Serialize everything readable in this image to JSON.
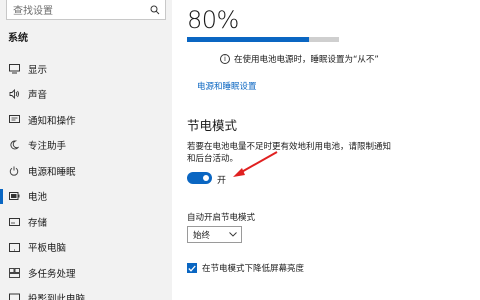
{
  "sidebar": {
    "search": {
      "placeholder": "查找设置"
    },
    "section_title": "系统",
    "items": [
      {
        "icon": "display-icon",
        "label": "显示"
      },
      {
        "icon": "sound-icon",
        "label": "声音"
      },
      {
        "icon": "notification-icon",
        "label": "通知和操作"
      },
      {
        "icon": "moon-icon",
        "label": "专注助手"
      },
      {
        "icon": "power-icon",
        "label": "电源和睡眠"
      },
      {
        "icon": "battery-icon",
        "label": "电池",
        "selected": true
      },
      {
        "icon": "storage-icon",
        "label": "存储"
      },
      {
        "icon": "tablet-icon",
        "label": "平板电脑"
      },
      {
        "icon": "multitask-icon",
        "label": "多任务处理"
      },
      {
        "icon": "projector-icon",
        "label": "投影到此电脑"
      }
    ]
  },
  "main": {
    "battery_percent": "80%",
    "battery_level": 0.8,
    "info_text": "在使用电池电源时，睡眠设置为“从不”",
    "power_sleep_link": "电源和睡眠设置",
    "battery_saver": {
      "heading": "节电模式",
      "description": "若要在电池电量不足时更有效地利用电池，请限制通知和后台活动。",
      "toggle_state": "开",
      "toggle_on": true,
      "auto_label": "自动开启节电模式",
      "auto_value": "始终",
      "lower_brightness_label": "在节电模式下降低屏幕亮度",
      "lower_brightness_checked": true
    }
  },
  "colors": {
    "accent": "#0a66c2",
    "sidebar_bg": "#f2f2f2",
    "annotation_red": "#e02020"
  }
}
